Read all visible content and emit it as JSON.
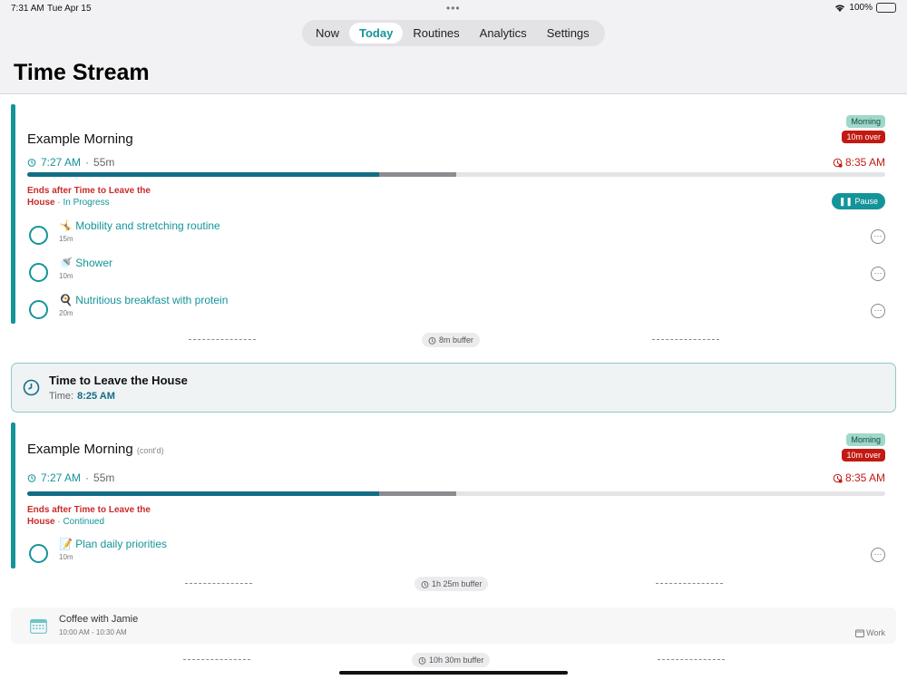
{
  "status_bar": {
    "time": "7:31 AM",
    "date": "Tue Apr 15",
    "wifi_icon": "wifi-icon",
    "battery": "100%"
  },
  "tabs": [
    {
      "label": "Now",
      "active": false
    },
    {
      "label": "Today",
      "active": true
    },
    {
      "label": "Routines",
      "active": false
    },
    {
      "label": "Analytics",
      "active": false
    },
    {
      "label": "Settings",
      "active": false
    }
  ],
  "page_title": "Time Stream",
  "colors": {
    "accent": "#14949a",
    "danger": "#c21a12",
    "progress": "#136d86"
  },
  "routine_1": {
    "title": "Example Morning",
    "badge": "Morning",
    "over_badge": "10m over",
    "start_time": "7:27 AM",
    "separator": "·",
    "duration": "55m",
    "end_time": "8:35 AM",
    "progress_done": 0.41,
    "progress_over_end": 0.5,
    "ends_line1": "Ends after Time to Leave the",
    "ends_line2": "House",
    "state": "In Progress",
    "pause_label": "Pause",
    "tasks": [
      {
        "emoji": "🤸",
        "name": "Mobility and stretching routine",
        "duration": "15m"
      },
      {
        "emoji": "🚿",
        "name": "Shower",
        "duration": "10m"
      },
      {
        "emoji": "🍳",
        "name": "Nutritious breakfast with protein",
        "duration": "20m"
      }
    ],
    "more_icon": "ellipsis-icon"
  },
  "buffer_1": "8m buffer",
  "leave_event": {
    "title": "Time to Leave the House",
    "time_label": "Time:",
    "time": "8:25 AM"
  },
  "routine_2": {
    "title": "Example Morning",
    "cont": "(cont'd)",
    "badge": "Morning",
    "over_badge": "10m over",
    "start_time": "7:27 AM",
    "separator": "·",
    "duration": "55m",
    "end_time": "8:35 AM",
    "progress_done": 0.41,
    "progress_over_end": 0.5,
    "ends_line1": "Ends after Time to Leave the",
    "ends_line2": "House",
    "state": "Continued",
    "tasks": [
      {
        "emoji": "📝",
        "name": "Plan daily priorities",
        "duration": "10m"
      }
    ]
  },
  "buffer_2": "1h 25m buffer",
  "calendar_event": {
    "title": "Coffee with Jamie",
    "time": "10:00 AM - 10:30 AM",
    "calendar": "Work"
  },
  "buffer_3": "10h 30m buffer"
}
